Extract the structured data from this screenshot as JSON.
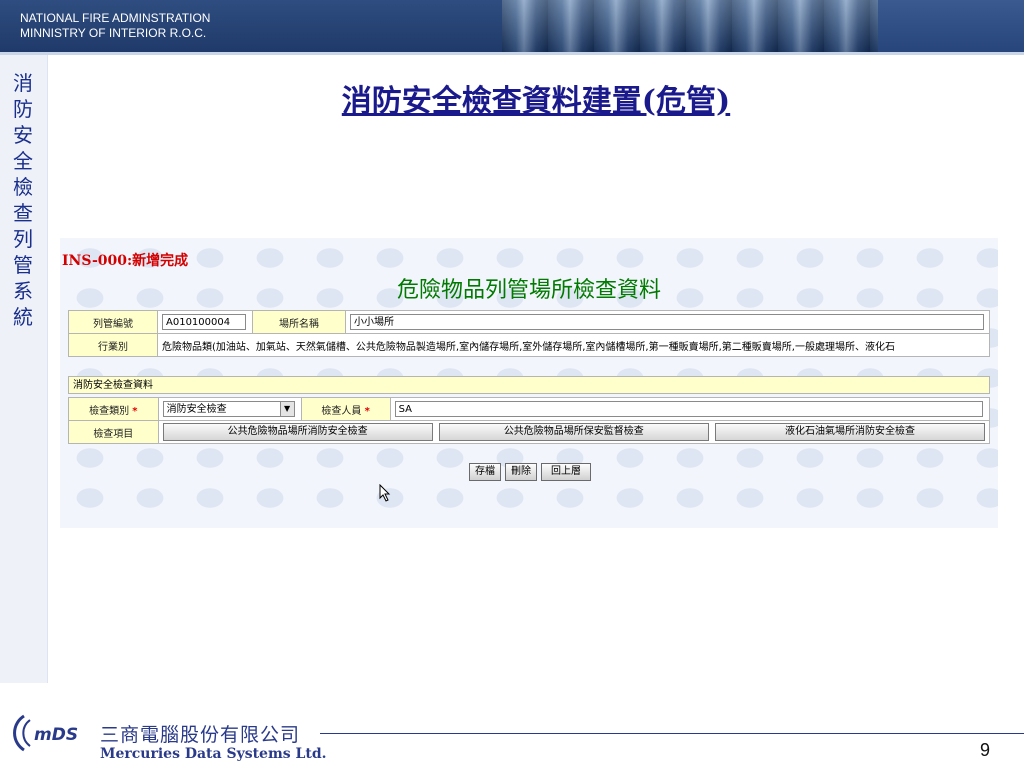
{
  "header": {
    "org_line1": "NATIONAL FIRE ADMINSTRATION",
    "org_line2": "MINNISTRY OF INTERIOR R.O.C."
  },
  "sidebar": {
    "title": "消防安全檢查列管系統"
  },
  "slide": {
    "title": "消防安全檢查資料建置(危管)",
    "page_number": "9"
  },
  "status_message": "INS-000:新增完成",
  "form": {
    "heading": "危險物品列管場所檢查資料",
    "fields": {
      "control_no_label": "列管編號",
      "control_no_value": "A010100004",
      "place_name_label": "場所名稱",
      "place_name_value": "小小場所",
      "industry_label": "行業別",
      "industry_value": "危險物品類(加油站、加氣站、天然氣儲槽、公共危險物品製造場所,室內儲存場所,室外儲存場所,室內儲槽場所,第一種販賣場所,第二種販賣場所,一般處理場所、液化石"
    },
    "section_title": "消防安全檢查資料",
    "inspection_type_label": "檢查類別",
    "inspection_type_value": "消防安全檢查",
    "inspector_label": "檢查人員",
    "inspector_value": "SA",
    "required_mark": "*",
    "items_label": "檢查項目",
    "item_buttons": [
      "公共危險物品場所消防安全檢查",
      "公共危險物品場所保安監督檢查",
      "液化石油氣場所消防安全檢查"
    ],
    "actions": {
      "save": "存檔",
      "delete": "刪除",
      "back": "回上層"
    }
  },
  "footer": {
    "logo_text": "mDS",
    "company_cn": "三商電腦股份有限公司",
    "company_en": "Mercuries Data Systems Ltd."
  },
  "colors": {
    "banner": "#1f3a6a",
    "title": "#1a1a8c",
    "label_bg": "#ffffcc",
    "status": "#d40000",
    "heading": "#007a00"
  }
}
